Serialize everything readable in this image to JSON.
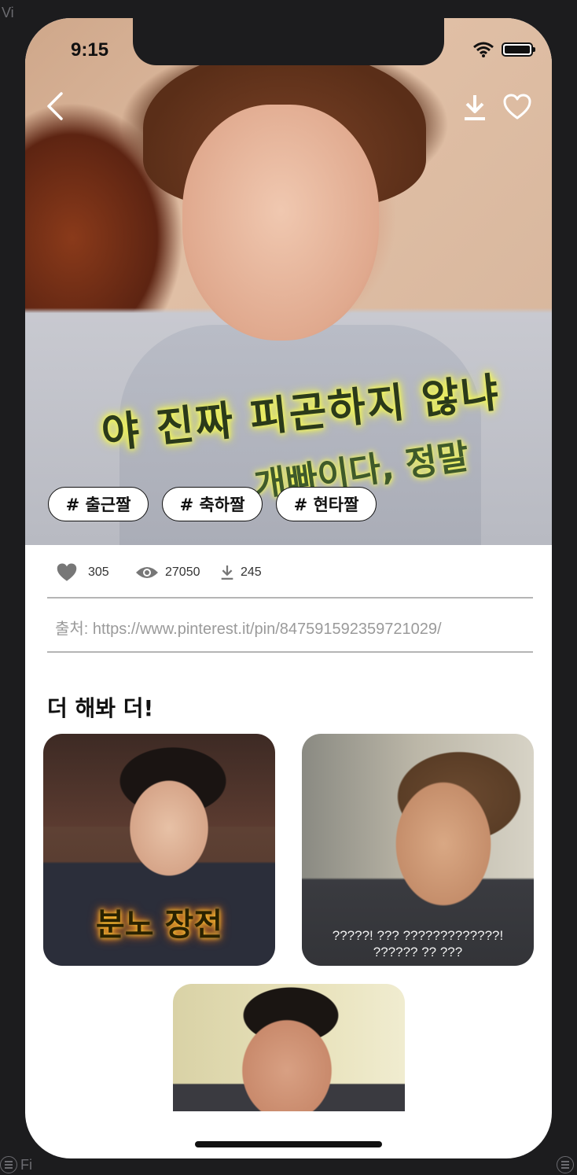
{
  "simulator": {
    "top_label": "Vi",
    "bottom_label": "Fi"
  },
  "status_bar": {
    "time": "9:15"
  },
  "hero": {
    "subtitle_line1": "야 진짜 피곤하지 않냐",
    "subtitle_line2": "개빠이다, 정말",
    "tags": [
      "# 출근짤",
      "# 축하짤",
      "# 현타짤"
    ]
  },
  "stats": {
    "likes": "305",
    "views": "27050",
    "downloads": "245"
  },
  "source": "출처: https://www.pinterest.it/pin/847591592359721029/",
  "related": {
    "title": "더 해봐 더!",
    "cards": [
      {
        "caption": "분노 장전"
      },
      {
        "caption_line1": "?????! ??? ?????????????!",
        "caption_line2": "?????? ?? ???"
      },
      {
        "caption": ""
      }
    ]
  },
  "colors": {
    "background": "#1c1c1e",
    "tag_border": "#111111",
    "divider": "#b5b5b5",
    "source_text": "#9a9a9a"
  }
}
